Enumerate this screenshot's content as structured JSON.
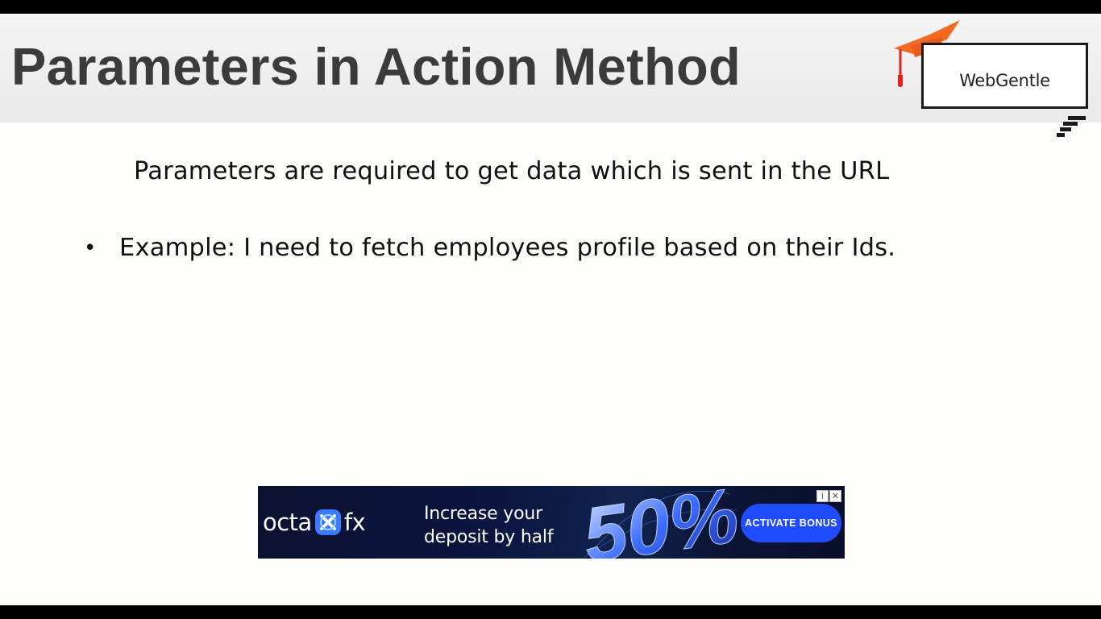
{
  "slide": {
    "title": "Parameters in Action Method",
    "logo_text": "WebGentle",
    "intro": "Parameters are required to get data which is sent in the URL",
    "bullets": [
      {
        "marker": "•",
        "text": "Example: I need to fetch employees profile based on their Ids."
      }
    ]
  },
  "ad": {
    "brand_left": "octa",
    "brand_right": "fx",
    "headline_line1": "Increase your",
    "headline_line2": "deposit by half",
    "graphic_text": "50%",
    "cta_label": "ACTIVATE BONUS",
    "info_icon": "i",
    "close_icon": "✕"
  },
  "colors": {
    "title": "#3b3b3b",
    "logo_cap": "#f26a21",
    "ad_background": "#0b1540",
    "ad_cta": "#1f4cff"
  }
}
